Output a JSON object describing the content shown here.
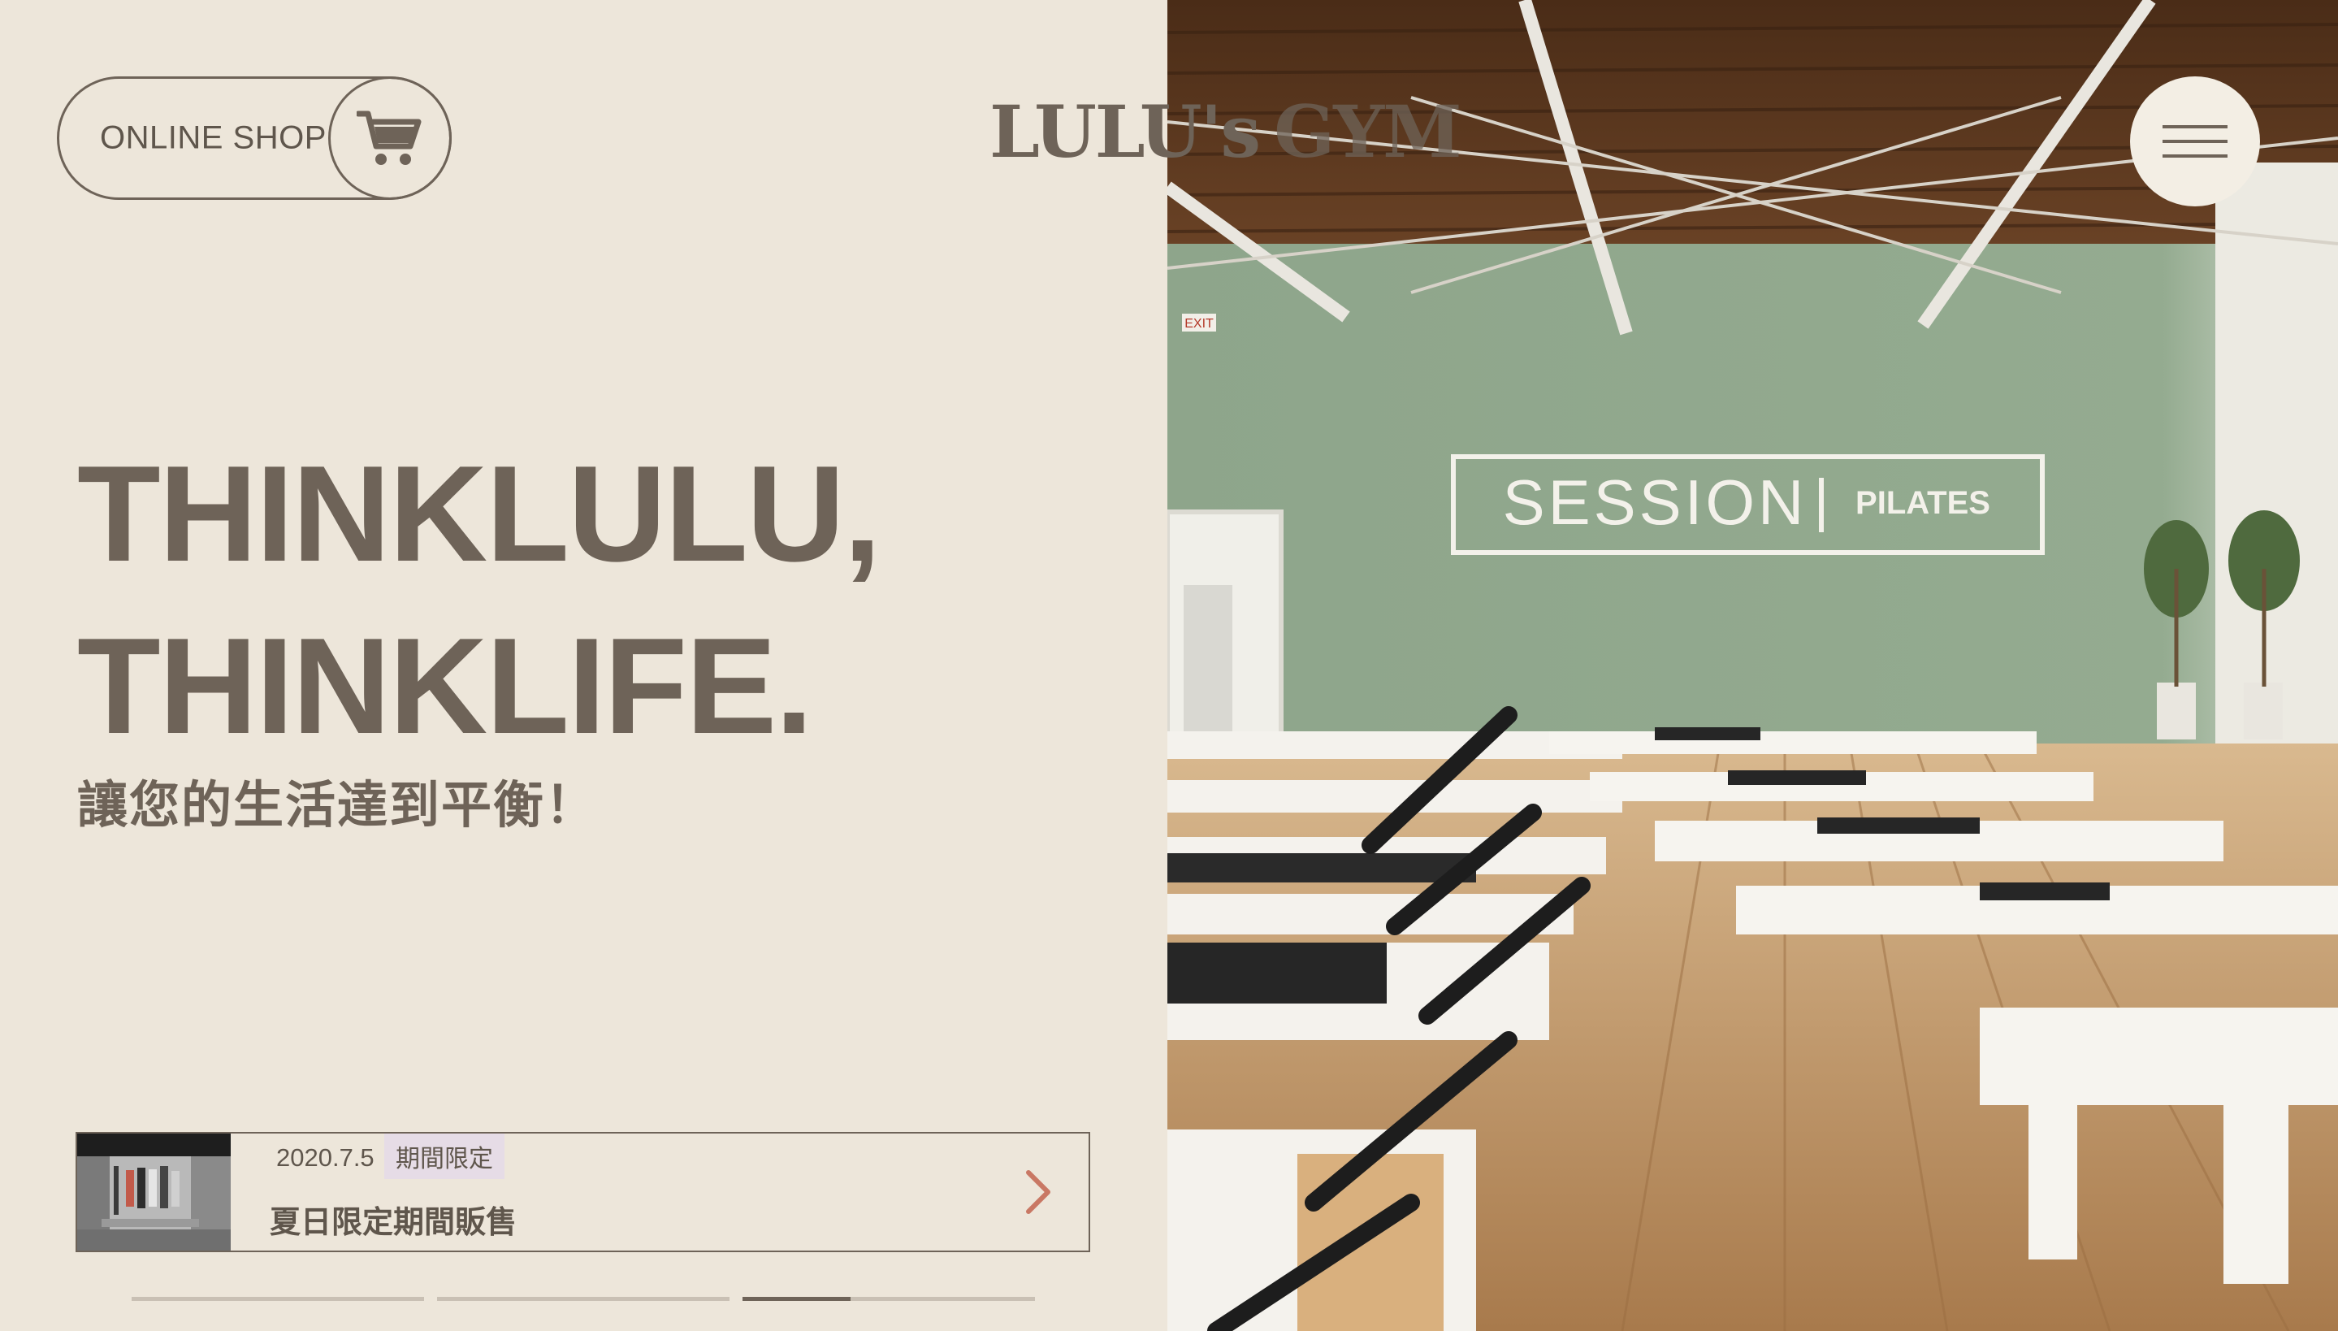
{
  "header": {
    "shop_label": "ONLINE SHOP",
    "logo_part_1": "LULU's",
    "logo_part_2": "GYM",
    "menu_icon": "hamburger-icon",
    "cart_icon": "cart-icon"
  },
  "hero": {
    "line1": "THINKLULU,",
    "line2": "THINKLIFE.",
    "subtitle": "讓您的生活達到平衡！"
  },
  "news": {
    "date": "2020.7.5",
    "tag": "期間限定",
    "title": "夏日限定期間販售",
    "arrow_icon": "chevron-right-icon"
  },
  "slider": {
    "count": 3,
    "active_index": 2,
    "active_progress": 0.37
  },
  "photo": {
    "sign_main": "SESSION",
    "sign_sub": "PILATES",
    "exit_sign": "EXIT"
  },
  "colors": {
    "background": "#ede6da",
    "text": "#6e6358",
    "accent_arrow": "#c97864",
    "tag_bg": "#e6dce6",
    "wall": "#8fa68c"
  }
}
